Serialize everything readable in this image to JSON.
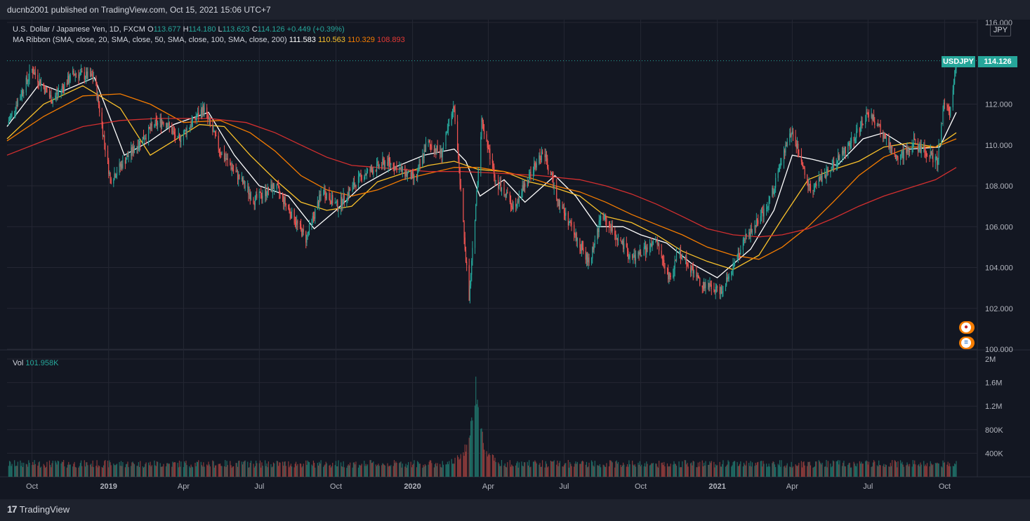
{
  "header": {
    "publisher_line": "ducnb2001 published on TradingView.com, Oct 15, 2021 15:06 UTC+7"
  },
  "legend": {
    "symbol_line": "U.S. Dollar / Japanese Yen, 1D, FXCM",
    "o_label": "O",
    "o_value": "113.677",
    "h_label": "H",
    "h_value": "114.180",
    "l_label": "L",
    "l_value": "113.623",
    "c_label": "C",
    "c_value": "114.126",
    "change": "+0.449 (+0.39%)",
    "ma_line": "MA Ribbon (SMA, close, 20, SMA, close, 50, SMA, close, 100, SMA, close, 200)",
    "ma20": "111.583",
    "ma50": "110.563",
    "ma100": "110.329",
    "ma200": "108.893",
    "vol_label": "Vol",
    "vol_value": "101.958K"
  },
  "price_scale": {
    "currency": "JPY",
    "symbol": "USDJPY",
    "last_price": "114.126"
  },
  "colors": {
    "up": "#26a69a",
    "down": "#ef5350",
    "ma20": "#ffffff",
    "ma50": "#f9c12b",
    "ma100": "#f57c00",
    "ma200": "#d32f2f",
    "background": "#131722",
    "grid": "#242733"
  },
  "icons": [
    "japan-flag-event-icon",
    "us-flag-event-icon",
    "tradingview-logo-icon"
  ],
  "footer": {
    "brand": "TradingView"
  },
  "chart_data": {
    "type": "candlestick",
    "title": "U.S. Dollar / Japanese Yen, 1D, FXCM",
    "y_ticks": [
      "116.000",
      "112.000",
      "110.000",
      "108.000",
      "106.000",
      "104.000",
      "102.000",
      "100.000"
    ],
    "ylim": [
      100,
      116
    ],
    "volume_ticks": [
      "2M",
      "1.6M",
      "1.2M",
      "800K",
      "400K"
    ],
    "volume_ylim": [
      0,
      2000000
    ],
    "x_ticks": [
      "Oct",
      "2019",
      "Apr",
      "Jul",
      "Oct",
      "2020",
      "Apr",
      "Jul",
      "Oct",
      "2021",
      "Apr",
      "Jul",
      "Oct"
    ],
    "x_tick_dates": [
      "2018-10-01",
      "2019-01-01",
      "2019-04-01",
      "2019-07-01",
      "2019-10-01",
      "2020-01-01",
      "2020-04-01",
      "2020-07-01",
      "2020-10-01",
      "2021-01-01",
      "2021-04-01",
      "2021-07-01",
      "2021-10-01"
    ],
    "xlim": [
      "2018-09-01",
      "2021-10-15"
    ],
    "price_path": [
      {
        "date": "2018-09-01",
        "close": 111.0
      },
      {
        "date": "2018-10-01",
        "close": 113.7
      },
      {
        "date": "2018-10-25",
        "close": 112.2
      },
      {
        "date": "2018-11-20",
        "close": 113.5
      },
      {
        "date": "2018-12-15",
        "close": 113.3
      },
      {
        "date": "2019-01-03",
        "close": 108.3
      },
      {
        "date": "2019-01-25",
        "close": 109.5
      },
      {
        "date": "2019-02-25",
        "close": 111.0
      },
      {
        "date": "2019-03-10",
        "close": 111.2
      },
      {
        "date": "2019-03-25",
        "close": 110.2
      },
      {
        "date": "2019-04-25",
        "close": 111.8
      },
      {
        "date": "2019-05-15",
        "close": 109.7
      },
      {
        "date": "2019-06-10",
        "close": 108.2
      },
      {
        "date": "2019-06-25",
        "close": 107.3
      },
      {
        "date": "2019-07-20",
        "close": 108.0
      },
      {
        "date": "2019-08-26",
        "close": 105.4
      },
      {
        "date": "2019-09-15",
        "close": 107.8
      },
      {
        "date": "2019-10-03",
        "close": 107.0
      },
      {
        "date": "2019-11-01",
        "close": 108.5
      },
      {
        "date": "2019-12-01",
        "close": 109.2
      },
      {
        "date": "2020-01-05",
        "close": 108.3
      },
      {
        "date": "2020-01-18",
        "close": 110.1
      },
      {
        "date": "2020-02-05",
        "close": 109.6
      },
      {
        "date": "2020-02-20",
        "close": 111.8
      },
      {
        "date": "2020-03-09",
        "close": 102.4
      },
      {
        "date": "2020-03-24",
        "close": 111.2
      },
      {
        "date": "2020-04-10",
        "close": 108.3
      },
      {
        "date": "2020-05-01",
        "close": 107.0
      },
      {
        "date": "2020-06-06",
        "close": 109.7
      },
      {
        "date": "2020-06-25",
        "close": 107.2
      },
      {
        "date": "2020-07-31",
        "close": 104.2
      },
      {
        "date": "2020-08-15",
        "close": 106.6
      },
      {
        "date": "2020-09-20",
        "close": 104.4
      },
      {
        "date": "2020-10-20",
        "close": 105.2
      },
      {
        "date": "2020-11-06",
        "close": 103.3
      },
      {
        "date": "2020-11-15",
        "close": 104.9
      },
      {
        "date": "2020-12-15",
        "close": 103.1
      },
      {
        "date": "2021-01-06",
        "close": 102.9
      },
      {
        "date": "2021-02-05",
        "close": 105.5
      },
      {
        "date": "2021-03-01",
        "close": 106.8
      },
      {
        "date": "2021-03-31",
        "close": 110.7
      },
      {
        "date": "2021-04-23",
        "close": 107.8
      },
      {
        "date": "2021-05-30",
        "close": 109.5
      },
      {
        "date": "2021-07-03",
        "close": 111.6
      },
      {
        "date": "2021-08-05",
        "close": 109.3
      },
      {
        "date": "2021-08-25",
        "close": 110.1
      },
      {
        "date": "2021-09-22",
        "close": 109.2
      },
      {
        "date": "2021-09-30",
        "close": 111.9
      },
      {
        "date": "2021-10-07",
        "close": 111.6
      },
      {
        "date": "2021-10-15",
        "close": 114.1
      }
    ],
    "ma_series": [
      {
        "name": "MA 20",
        "points": [
          [
            "2018-09-01",
            110.9
          ],
          [
            "2018-10-10",
            113.0
          ],
          [
            "2018-11-05",
            112.6
          ],
          [
            "2018-12-15",
            113.3
          ],
          [
            "2019-01-20",
            109.5
          ],
          [
            "2019-02-20",
            110.2
          ],
          [
            "2019-03-20",
            111.0
          ],
          [
            "2019-05-01",
            111.6
          ],
          [
            "2019-06-01",
            109.5
          ],
          [
            "2019-07-01",
            108.0
          ],
          [
            "2019-08-05",
            107.5
          ],
          [
            "2019-09-05",
            105.9
          ],
          [
            "2019-10-01",
            106.8
          ],
          [
            "2019-11-01",
            108.0
          ],
          [
            "2019-12-10",
            108.9
          ],
          [
            "2020-01-15",
            109.5
          ],
          [
            "2020-02-20",
            109.8
          ],
          [
            "2020-03-05",
            109.2
          ],
          [
            "2020-03-22",
            107.5
          ],
          [
            "2020-04-20",
            108.3
          ],
          [
            "2020-05-15",
            107.2
          ],
          [
            "2020-06-20",
            108.5
          ],
          [
            "2020-07-15",
            107.5
          ],
          [
            "2020-08-10",
            106.0
          ],
          [
            "2020-09-10",
            106.0
          ],
          [
            "2020-10-01",
            105.6
          ],
          [
            "2020-11-01",
            105.2
          ],
          [
            "2020-12-01",
            104.2
          ],
          [
            "2021-01-01",
            103.5
          ],
          [
            "2021-02-10",
            104.9
          ],
          [
            "2021-03-10",
            106.8
          ],
          [
            "2021-04-01",
            109.5
          ],
          [
            "2021-04-25",
            109.3
          ],
          [
            "2021-05-25",
            109.0
          ],
          [
            "2021-06-25",
            110.3
          ],
          [
            "2021-07-20",
            110.6
          ],
          [
            "2021-08-20",
            109.8
          ],
          [
            "2021-09-25",
            109.9
          ],
          [
            "2021-10-15",
            111.6
          ]
        ]
      },
      {
        "name": "MA 50",
        "points": [
          [
            "2018-09-01",
            110.3
          ],
          [
            "2018-10-15",
            112.0
          ],
          [
            "2018-12-01",
            112.9
          ],
          [
            "2019-01-15",
            111.8
          ],
          [
            "2019-02-20",
            109.5
          ],
          [
            "2019-03-20",
            110.2
          ],
          [
            "2019-04-20",
            111.0
          ],
          [
            "2019-05-20",
            110.9
          ],
          [
            "2019-06-20",
            109.5
          ],
          [
            "2019-07-20",
            108.3
          ],
          [
            "2019-08-20",
            107.2
          ],
          [
            "2019-09-20",
            106.8
          ],
          [
            "2019-10-20",
            107.0
          ],
          [
            "2019-11-20",
            108.2
          ],
          [
            "2019-12-20",
            108.6
          ],
          [
            "2020-01-20",
            109.0
          ],
          [
            "2020-02-20",
            109.2
          ],
          [
            "2020-03-20",
            108.8
          ],
          [
            "2020-04-20",
            108.7
          ],
          [
            "2020-05-20",
            108.2
          ],
          [
            "2020-06-20",
            107.9
          ],
          [
            "2020-07-20",
            107.5
          ],
          [
            "2020-08-20",
            106.5
          ],
          [
            "2020-09-20",
            106.2
          ],
          [
            "2020-10-20",
            105.6
          ],
          [
            "2020-11-20",
            104.8
          ],
          [
            "2020-12-20",
            104.3
          ],
          [
            "2021-01-20",
            103.9
          ],
          [
            "2021-02-20",
            104.6
          ],
          [
            "2021-03-20",
            106.4
          ],
          [
            "2021-04-20",
            108.3
          ],
          [
            "2021-05-20",
            108.8
          ],
          [
            "2021-06-20",
            109.2
          ],
          [
            "2021-07-20",
            109.9
          ],
          [
            "2021-08-20",
            110.1
          ],
          [
            "2021-09-20",
            109.9
          ],
          [
            "2021-10-15",
            110.6
          ]
        ]
      },
      {
        "name": "MA 100",
        "points": [
          [
            "2018-09-01",
            110.2
          ],
          [
            "2018-10-15",
            111.4
          ],
          [
            "2018-12-01",
            112.4
          ],
          [
            "2019-01-15",
            112.5
          ],
          [
            "2019-02-20",
            112.0
          ],
          [
            "2019-04-01",
            111.1
          ],
          [
            "2019-05-15",
            111.2
          ],
          [
            "2019-06-20",
            110.6
          ],
          [
            "2019-07-20",
            109.7
          ],
          [
            "2019-08-20",
            108.5
          ],
          [
            "2019-09-20",
            107.8
          ],
          [
            "2019-10-20",
            107.5
          ],
          [
            "2019-11-20",
            107.8
          ],
          [
            "2019-12-20",
            108.3
          ],
          [
            "2020-01-20",
            108.6
          ],
          [
            "2020-02-20",
            108.9
          ],
          [
            "2020-03-20",
            108.9
          ],
          [
            "2020-04-20",
            108.7
          ],
          [
            "2020-05-20",
            108.4
          ],
          [
            "2020-06-20",
            108.0
          ],
          [
            "2020-07-20",
            107.7
          ],
          [
            "2020-08-20",
            107.2
          ],
          [
            "2020-09-20",
            106.6
          ],
          [
            "2020-10-20",
            106.1
          ],
          [
            "2020-11-20",
            105.6
          ],
          [
            "2020-12-20",
            105.0
          ],
          [
            "2021-01-20",
            104.6
          ],
          [
            "2021-02-20",
            104.4
          ],
          [
            "2021-03-20",
            105.0
          ],
          [
            "2021-04-20",
            106.0
          ],
          [
            "2021-05-20",
            107.2
          ],
          [
            "2021-06-20",
            108.5
          ],
          [
            "2021-07-20",
            109.4
          ],
          [
            "2021-08-20",
            109.9
          ],
          [
            "2021-09-20",
            109.9
          ],
          [
            "2021-10-15",
            110.3
          ]
        ]
      },
      {
        "name": "MA 200",
        "points": [
          [
            "2018-09-01",
            109.5
          ],
          [
            "2018-10-15",
            110.2
          ],
          [
            "2018-12-01",
            110.9
          ],
          [
            "2019-01-15",
            111.2
          ],
          [
            "2019-03-01",
            111.3
          ],
          [
            "2019-05-01",
            111.3
          ],
          [
            "2019-06-15",
            111.1
          ],
          [
            "2019-07-20",
            110.6
          ],
          [
            "2019-08-20",
            110.0
          ],
          [
            "2019-09-20",
            109.4
          ],
          [
            "2019-10-20",
            109.0
          ],
          [
            "2019-11-20",
            108.9
          ],
          [
            "2019-12-20",
            108.8
          ],
          [
            "2020-01-20",
            108.7
          ],
          [
            "2020-03-01",
            108.7
          ],
          [
            "2020-04-20",
            108.6
          ],
          [
            "2020-06-01",
            108.5
          ],
          [
            "2020-07-20",
            108.3
          ],
          [
            "2020-08-20",
            108.0
          ],
          [
            "2020-09-20",
            107.6
          ],
          [
            "2020-10-20",
            107.1
          ],
          [
            "2020-11-20",
            106.5
          ],
          [
            "2020-12-20",
            105.9
          ],
          [
            "2021-01-20",
            105.6
          ],
          [
            "2021-02-20",
            105.5
          ],
          [
            "2021-03-20",
            105.6
          ],
          [
            "2021-04-20",
            105.9
          ],
          [
            "2021-05-20",
            106.4
          ],
          [
            "2021-06-20",
            107.0
          ],
          [
            "2021-07-20",
            107.5
          ],
          [
            "2021-08-20",
            107.9
          ],
          [
            "2021-09-20",
            108.3
          ],
          [
            "2021-10-15",
            108.9
          ]
        ]
      }
    ],
    "volume_baseline": 220000,
    "volume_spike": {
      "date": "2020-03-17",
      "value": 1850000
    }
  }
}
